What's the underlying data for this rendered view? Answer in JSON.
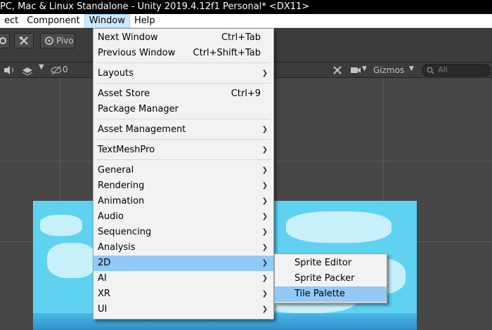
{
  "window": {
    "title": "PC, Mac & Linux Standalone - Unity 2019.4.12f1 Personal* <DX11>"
  },
  "menubar": {
    "items": [
      "ect",
      "Component",
      "Window",
      "Help"
    ]
  },
  "toolbar": {
    "pivot_label": "Pivo"
  },
  "scene_toolbar": {
    "layers_count": "0",
    "gizmos_label": "Gizmos",
    "search_placeholder": "All"
  },
  "window_menu": {
    "items": [
      {
        "label": "Next Window",
        "shortcut": "Ctrl+Tab"
      },
      {
        "label": "Previous Window",
        "shortcut": "Ctrl+Shift+Tab"
      },
      {
        "label": "Layouts"
      },
      {
        "label": "Asset Store",
        "shortcut": "Ctrl+9"
      },
      {
        "label": "Package Manager"
      },
      {
        "label": "Asset Management"
      },
      {
        "label": "TextMeshPro"
      },
      {
        "label": "General"
      },
      {
        "label": "Rendering"
      },
      {
        "label": "Animation"
      },
      {
        "label": "Audio"
      },
      {
        "label": "Sequencing"
      },
      {
        "label": "Analysis"
      },
      {
        "label": "2D"
      },
      {
        "label": "AI"
      },
      {
        "label": "XR"
      },
      {
        "label": "UI"
      }
    ]
  },
  "submenu_2d": {
    "items": [
      "Sprite Editor",
      "Sprite Packer",
      "Tile Palette"
    ]
  },
  "colors": {
    "highlight": "#91c9f7",
    "menu_bg": "#f2f2f2",
    "sky": "#5fd2f2"
  }
}
